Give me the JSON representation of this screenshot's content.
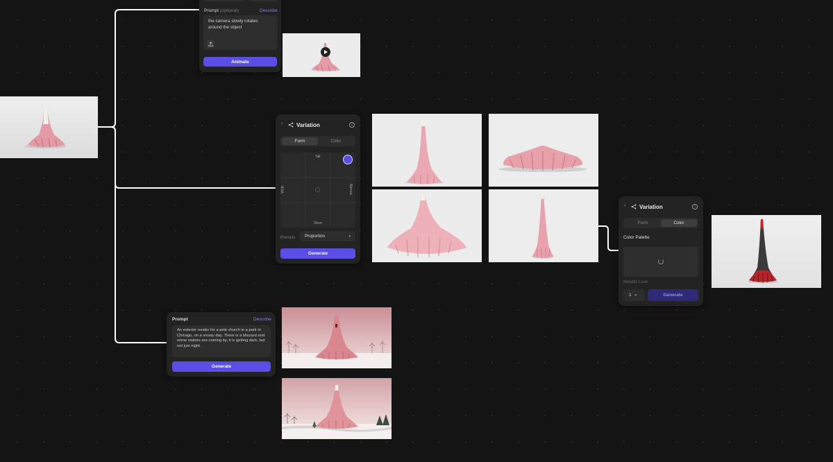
{
  "animate_panel": {
    "prompt_label": "Prompt",
    "prompt_optional": "(optional)",
    "describe_link": "Describe",
    "prompt_text": "the camera slowly rotates around the object",
    "animate_button": "Animate"
  },
  "variation_form_panel": {
    "title": "Variation",
    "tab_form": "Form",
    "tab_color": "Color",
    "axis_top": "Tall",
    "axis_bottom": "Short",
    "axis_left": "Wide",
    "axis_right": "Narrow",
    "presets_label": "Presets",
    "presets_value": "Proportion",
    "generate_button": "Generate"
  },
  "variation_color_panel": {
    "title": "Variation",
    "tab_form": "Form",
    "tab_color": "Color",
    "palette_label": "Color Palette",
    "palette_name": "Metallic Luxe",
    "count_value": "1",
    "generate_button": "Generate"
  },
  "prompt_panel": {
    "prompt_label": "Prompt",
    "describe_link": "Describe",
    "prompt_text": "An exterior render for a pink church in a park in Chicago, on a snowy day. There is a blizzard and some visitors are coming by, it is getting dark, but not just night .",
    "generate_button": "Generate"
  },
  "colors": {
    "canvas_bg": "#141414",
    "panel_bg": "#232323",
    "accent": "#5a4ee6",
    "link": "#8a7ff5",
    "connector": "#ffffff",
    "object_pink": "#e8a3ad",
    "object_red": "#b8232a"
  }
}
